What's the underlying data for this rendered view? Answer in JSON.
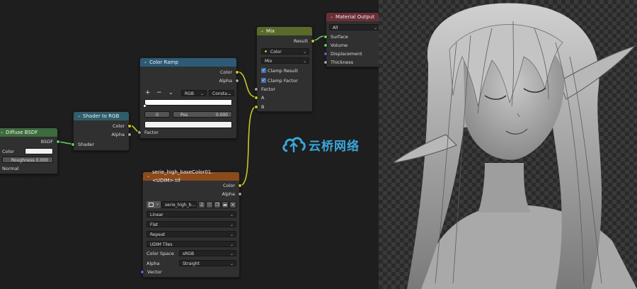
{
  "nodes": {
    "diffuse": {
      "title": "Diffuse BSDF",
      "output": "BSDF",
      "color_label": "Color",
      "roughness_label": "Roughness",
      "roughness_value": "0.000",
      "normal_label": "Normal"
    },
    "shader_to_rgb": {
      "title": "Shader to RGB",
      "out_color": "Color",
      "out_alpha": "Alpha",
      "in_shader": "Shader"
    },
    "color_ramp": {
      "title": "Color Ramp",
      "out_color": "Color",
      "out_alpha": "Alpha",
      "add": "+",
      "remove": "−",
      "menu": "⌄",
      "mode": "RGB",
      "interp": "Consta...",
      "index": "0",
      "pos_label": "Pos",
      "pos_value": "0.000",
      "in_factor": "Factor"
    },
    "mix": {
      "title": "Mix",
      "out_result": "Result",
      "data_type": "Color",
      "blend": "Mix",
      "clamp_result": "Clamp Result",
      "clamp_factor": "Clamp Factor",
      "in_factor": "Factor",
      "in_a": "A",
      "in_b": "B"
    },
    "material_output": {
      "title": "Material Output",
      "target": "All",
      "surface": "Surface",
      "volume": "Volume",
      "displacement": "Displacement",
      "thickness": "Thickness"
    },
    "image_texture": {
      "title": "serie_high_baseColor01.<UDIM>.tif",
      "out_color": "Color",
      "out_alpha": "Alpha",
      "image_name": "serie_high_b...",
      "users": "2",
      "interpolation": "Linear",
      "projection": "Flat",
      "extension": "Repeat",
      "source": "UDIM Tiles",
      "color_space_label": "Color Space",
      "color_space": "sRGB",
      "alpha_label": "Alpha",
      "alpha": "Straight",
      "in_vector": "Vector"
    }
  },
  "watermark": {
    "text": "云桥网络"
  },
  "colors": {
    "socket_color": "#c7c729",
    "socket_float": "#a1a1a1",
    "socket_shader": "#63c763",
    "socket_vector": "#6363c7",
    "checkbox": "#4772b3"
  }
}
